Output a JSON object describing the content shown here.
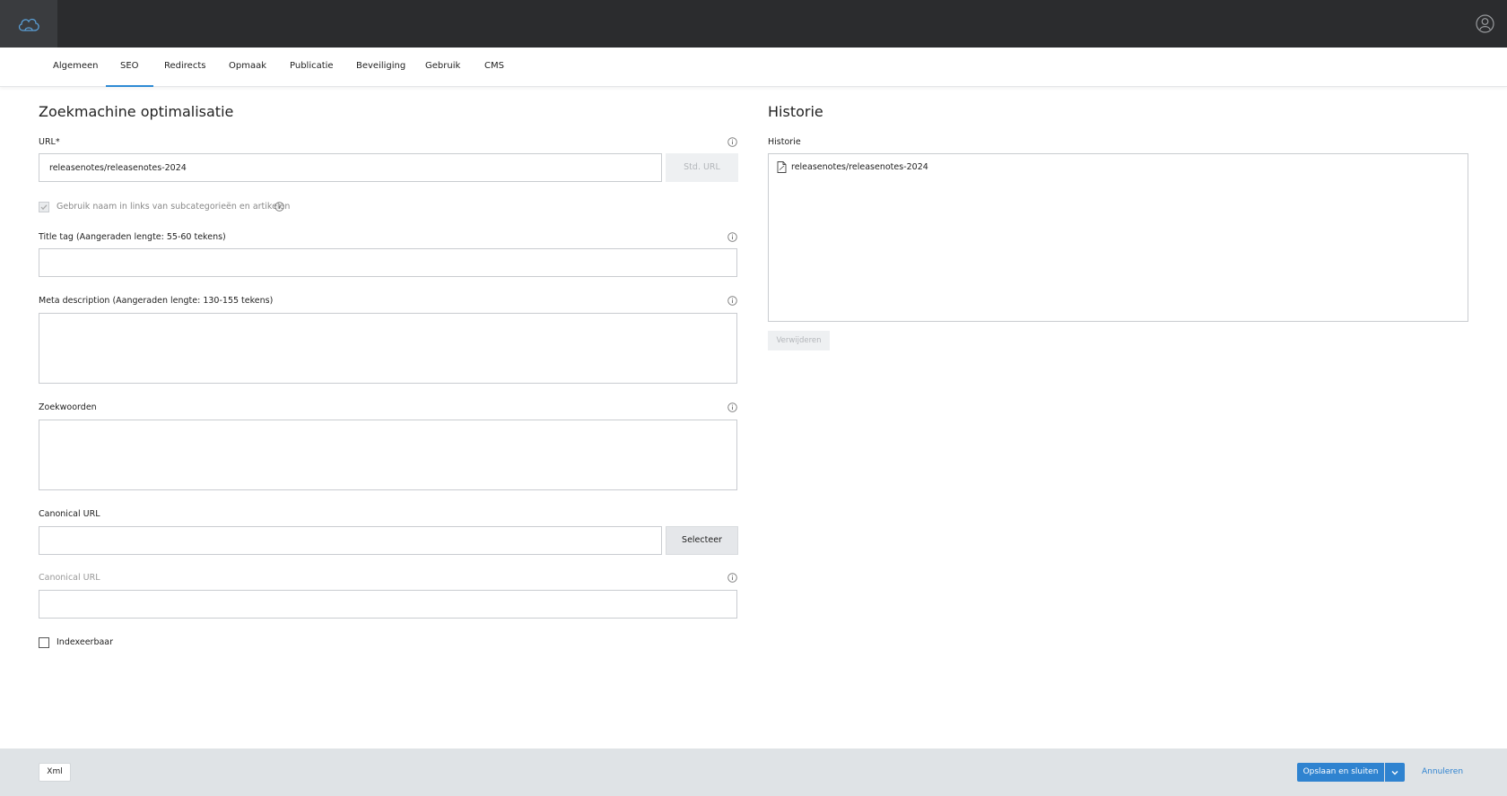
{
  "tabs": [
    {
      "label": "Algemeen",
      "active": false
    },
    {
      "label": "SEO",
      "active": true
    },
    {
      "label": "Redirects",
      "active": false
    },
    {
      "label": "Opmaak",
      "active": false
    },
    {
      "label": "Publicatie",
      "active": false
    },
    {
      "label": "Beveiliging",
      "active": false
    },
    {
      "label": "Gebruik",
      "active": false
    },
    {
      "label": "CMS",
      "active": false
    }
  ],
  "seo": {
    "title": "Zoekmachine optimalisatie",
    "url_label": "URL*",
    "url_value": "releasenotes/releasenotes-2024",
    "std_url_label": "Std. URL",
    "use_name_label": "Gebruik naam in links van subcategorieën en artikelen",
    "title_tag_label": "Title tag (Aangeraden lengte: 55-60 tekens)",
    "title_tag_value": "",
    "meta_description_label": "Meta description (Aangeraden lengte: 130-155 tekens)",
    "meta_description_value": "",
    "keywords_label": "Zoekwoorden",
    "keywords_value": "",
    "canonical_label": "Canonical URL",
    "canonical_value": "",
    "select_label": "Selecteer",
    "canonical2_label": "Canonical URL",
    "canonical2_value": "",
    "indexable_label": "Indexeerbaar"
  },
  "history": {
    "title": "Historie",
    "list_label": "Historie",
    "items": [
      "releasenotes/releasenotes-2024"
    ],
    "delete_label": "Verwijderen"
  },
  "footer": {
    "xml_label": "Xml",
    "save_label": "Opslaan en sluiten",
    "cancel_label": "Annuleren"
  },
  "colors": {
    "topbar": "#2b2c2e",
    "accent": "#2f83d0",
    "footer": "#dfe3e6"
  },
  "icons": {
    "logo": "cloud-logo-icon",
    "user": "user-circle-icon",
    "info": "info-icon",
    "file": "file-icon",
    "dropdown": "chevron-down-icon"
  }
}
